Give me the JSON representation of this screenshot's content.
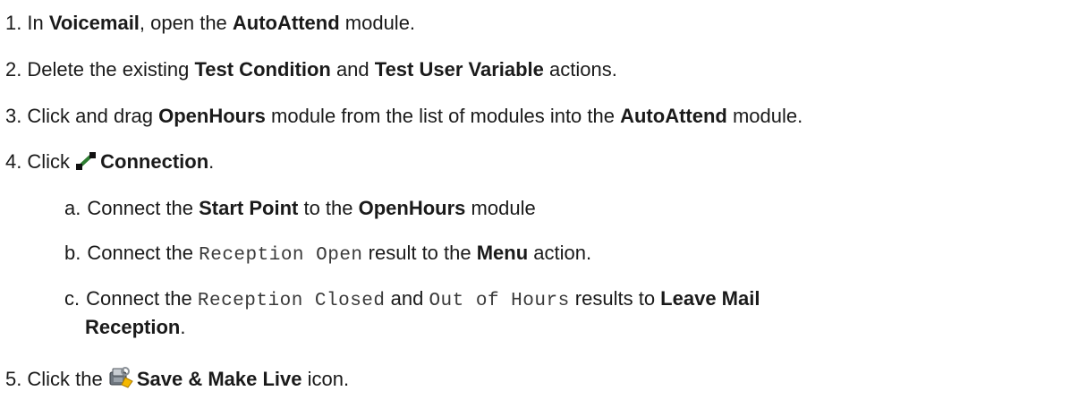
{
  "steps": [
    {
      "num": "1.",
      "t1": "In ",
      "b1": "Voicemail",
      "t2": ", open the ",
      "b2": "AutoAttend",
      "t3": " module."
    },
    {
      "num": "2.",
      "t1": "Delete the existing ",
      "b1": "Test Condition",
      "t2": " and ",
      "b2": "Test User Variable",
      "t3": " actions."
    },
    {
      "num": "3.",
      "t1": "Click and drag ",
      "b1": "OpenHours",
      "t2": " module from the list of modules into the ",
      "b2": "AutoAttend",
      "t3": " module."
    },
    {
      "num": "4.",
      "t1": "Click ",
      "icon": "connection-icon",
      "b1": "Connection",
      "t2": ".",
      "substeps": [
        {
          "num": "a.",
          "t1": "Connect the ",
          "b1": "Start Point",
          "t2": " to the ",
          "b2": "OpenHours",
          "t3": " module"
        },
        {
          "num": "b.",
          "t1": "Connect the ",
          "code1": "Reception Open",
          "t2": " result to the ",
          "b1": "Menu",
          "t3": " action."
        },
        {
          "num": "c.",
          "t1": "Connect the ",
          "code1": "Reception Closed",
          "t2": " and ",
          "code2": "Out of Hours",
          "t3": " results to ",
          "b1": "Leave Mail",
          "b2": "Reception",
          "t4": "."
        }
      ]
    },
    {
      "num": "5.",
      "t1": "Click the ",
      "icon": "save-make-live-icon",
      "b1": "Save & Make Live",
      "t2": " icon."
    }
  ]
}
